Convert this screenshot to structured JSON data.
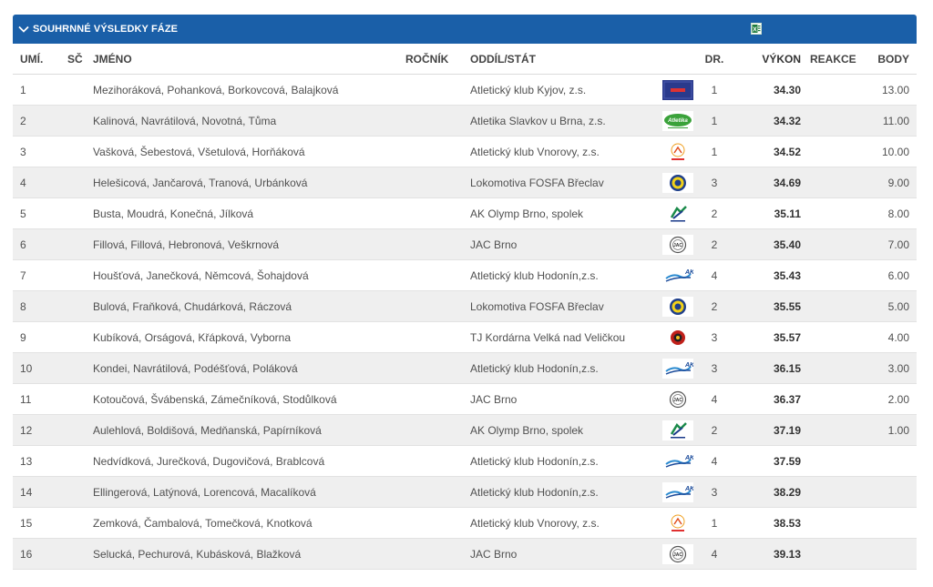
{
  "header": {
    "title": "SOUHRNNÉ VÝSLEDKY FÁZE",
    "export_icon": "excel-icon"
  },
  "columns": {
    "rank": "UMÍ.",
    "bib": "SČ",
    "name": "JMÉNO",
    "year": "ROČNÍK",
    "club": "ODDÍL/STÁT",
    "lane": "DR.",
    "result": "VÝKON",
    "reaction": "REAKCE",
    "points": "BODY"
  },
  "rows": [
    {
      "rank": "1",
      "name": "Mezihoráková, Pohanková, Borkovcová, Balajková",
      "club": "Atletický klub Kyjov, z.s.",
      "logo": "kyjov",
      "lane": "1",
      "result": "34.30",
      "points": "13.00"
    },
    {
      "rank": "2",
      "name": "Kalinová, Navrátilová, Novotná, Tůma",
      "club": "Atletika Slavkov u Brna, z.s.",
      "logo": "slavkov",
      "lane": "1",
      "result": "34.32",
      "points": "11.00"
    },
    {
      "rank": "3",
      "name": "Vašková, Šebestová, Všetulová, Horňáková",
      "club": "Atletický klub Vnorovy, z.s.",
      "logo": "vnorovy",
      "lane": "1",
      "result": "34.52",
      "points": "10.00"
    },
    {
      "rank": "4",
      "name": "Helešicová, Jančarová, Tranová, Urbánková",
      "club": "Lokomotiva FOSFA Břeclav",
      "logo": "fosfa",
      "lane": "3",
      "result": "34.69",
      "points": "9.00"
    },
    {
      "rank": "5",
      "name": "Busta, Moudrá, Konečná, Jílková",
      "club": "AK Olymp Brno, spolek",
      "logo": "olymp",
      "lane": "2",
      "result": "35.11",
      "points": "8.00"
    },
    {
      "rank": "6",
      "name": "Fillová, Fillová, Hebronová, Veškrnová",
      "club": "JAC Brno",
      "logo": "jac",
      "lane": "2",
      "result": "35.40",
      "points": "7.00"
    },
    {
      "rank": "7",
      "name": "Houšťová, Janečková, Němcová, Šohajdová",
      "club": "Atletický klub Hodonín,z.s.",
      "logo": "hodonin",
      "lane": "4",
      "result": "35.43",
      "points": "6.00"
    },
    {
      "rank": "8",
      "name": "Bulová, Fraňková, Chudárková, Ráczová",
      "club": "Lokomotiva FOSFA Břeclav",
      "logo": "fosfa",
      "lane": "2",
      "result": "35.55",
      "points": "5.00"
    },
    {
      "rank": "9",
      "name": "Kubíková, Orságová, Křápková, Vyborna",
      "club": "TJ Kordárna Velká nad Veličkou",
      "logo": "kordarna",
      "lane": "3",
      "result": "35.57",
      "points": "4.00"
    },
    {
      "rank": "10",
      "name": "Kondei, Navrátilová, Podéšťová, Poláková",
      "club": "Atletický klub Hodonín,z.s.",
      "logo": "hodonin",
      "lane": "3",
      "result": "36.15",
      "points": "3.00"
    },
    {
      "rank": "11",
      "name": "Kotoučová, Švábenská, Zámečníková, Stodůlková",
      "club": "JAC Brno",
      "logo": "jac",
      "lane": "4",
      "result": "36.37",
      "points": "2.00"
    },
    {
      "rank": "12",
      "name": "Aulehlová, Boldišová, Medňanská, Papírníková",
      "club": "AK Olymp Brno, spolek",
      "logo": "olymp",
      "lane": "2",
      "result": "37.19",
      "points": "1.00"
    },
    {
      "rank": "13",
      "name": "Nedvídková, Jurečková, Dugovičová, Brablcová",
      "club": "Atletický klub Hodonín,z.s.",
      "logo": "hodonin",
      "lane": "4",
      "result": "37.59",
      "points": ""
    },
    {
      "rank": "14",
      "name": "Ellingerová, Latýnová, Lorencová, Macalíková",
      "club": "Atletický klub Hodonín,z.s.",
      "logo": "hodonin",
      "lane": "3",
      "result": "38.29",
      "points": ""
    },
    {
      "rank": "15",
      "name": "Zemková, Čambalová, Tomečková, Knotková",
      "club": "Atletický klub Vnorovy, z.s.",
      "logo": "vnorovy",
      "lane": "1",
      "result": "38.53",
      "points": ""
    },
    {
      "rank": "16",
      "name": "Selucká, Pechurová, Kubásková, Blažková",
      "club": "JAC Brno",
      "logo": "jac",
      "lane": "4",
      "result": "39.13",
      "points": ""
    }
  ],
  "colors": {
    "header_bg": "#1a5fa8",
    "row_alt": "#efefef",
    "excel_green": "#1e7b3c"
  }
}
